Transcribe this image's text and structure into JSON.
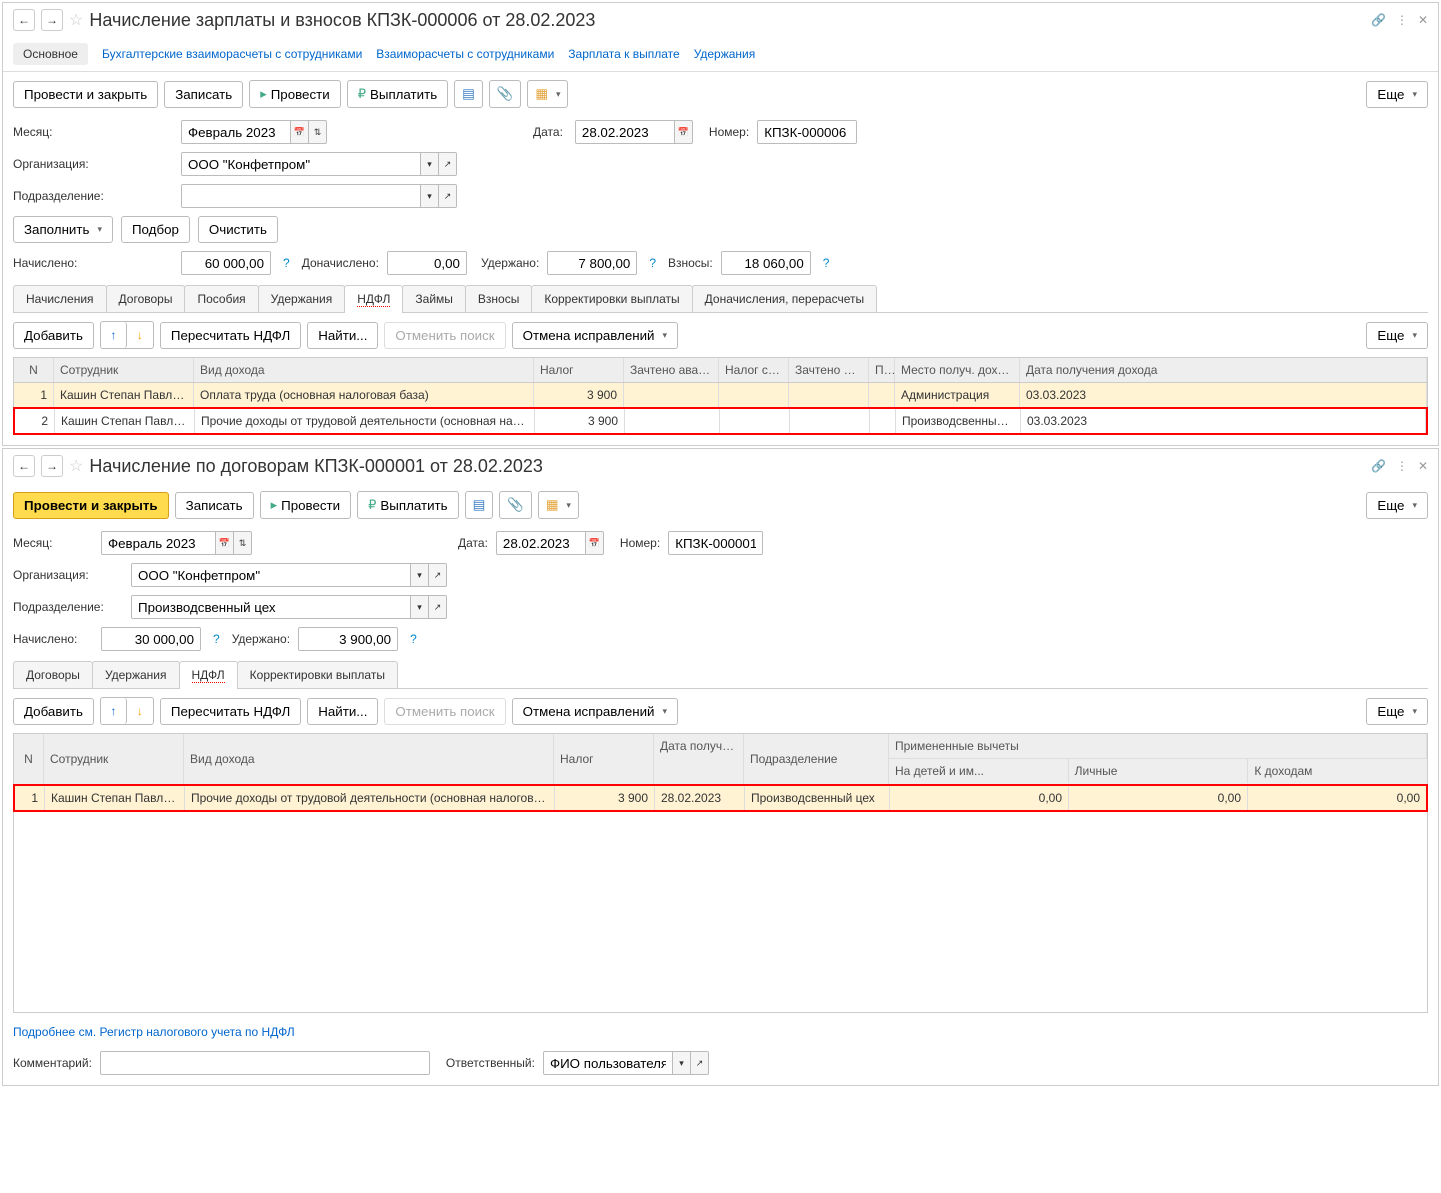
{
  "doc1": {
    "title": "Начисление зарплаты и взносов КПЗК-000006 от 28.02.2023",
    "nav_tabs": {
      "main": "Основное",
      "link1": "Бухгалтерские взаиморасчеты с сотрудниками",
      "link2": "Взаиморасчеты с сотрудниками",
      "link3": "Зарплата к выплате",
      "link4": "Удержания"
    },
    "toolbar": {
      "post_close": "Провести и закрыть",
      "save": "Записать",
      "post": "Провести",
      "pay": "Выплатить",
      "more": "Еще"
    },
    "fields": {
      "month_label": "Месяц:",
      "month_value": "Февраль 2023",
      "date_label": "Дата:",
      "date_value": "28.02.2023",
      "number_label": "Номер:",
      "number_value": "КПЗК-000006",
      "org_label": "Организация:",
      "org_value": "ООО \"Конфетпром\"",
      "dept_label": "Подразделение:",
      "dept_value": "",
      "fill": "Заполнить",
      "select": "Подбор",
      "clear": "Очистить",
      "accrued_label": "Начислено:",
      "accrued_value": "60 000,00",
      "accrued_extra_label": "Доначислено:",
      "accrued_extra_value": "0,00",
      "withheld_label": "Удержано:",
      "withheld_value": "7 800,00",
      "contrib_label": "Взносы:",
      "contrib_value": "18 060,00"
    },
    "tabs": [
      "Начисления",
      "Договоры",
      "Пособия",
      "Удержания",
      "НДФЛ",
      "Займы",
      "Взносы",
      "Корректировки выплаты",
      "Доначисления, перерасчеты"
    ],
    "active_tab": "НДФЛ",
    "sub_toolbar": {
      "add": "Добавить",
      "recalc": "Пересчитать НДФЛ",
      "find": "Найти...",
      "cancel_search": "Отменить поиск",
      "undo_fix": "Отмена исправлений",
      "more": "Еще"
    },
    "table": {
      "headers": [
        "N",
        "Сотрудник",
        "Вид дохода",
        "Налог",
        "Зачтено авансов",
        "Налог с пр...",
        "Зачтено аван...",
        "П...",
        "Место получ. дохода",
        "Дата получения дохода"
      ],
      "rows": [
        {
          "n": "1",
          "emp": "Кашин Степан Павлович",
          "income": "Оплата труда (основная налоговая база)",
          "tax": "3 900",
          "adv": "",
          "taxp": "",
          "adv2": "",
          "p": "",
          "place": "Администрация",
          "date": "03.03.2023",
          "sel": true
        },
        {
          "n": "2",
          "emp": "Кашин Степан Павлович",
          "income": "Прочие доходы от трудовой деятельности (основная налоговая база)",
          "tax": "3 900",
          "adv": "",
          "taxp": "",
          "adv2": "",
          "p": "",
          "place": "Производсвенный цех",
          "date": "03.03.2023",
          "sel": false
        }
      ]
    }
  },
  "doc2": {
    "title": "Начисление по договорам КПЗК-000001 от 28.02.2023",
    "toolbar": {
      "post_close": "Провести и закрыть",
      "save": "Записать",
      "post": "Провести",
      "pay": "Выплатить",
      "more": "Еще"
    },
    "fields": {
      "month_label": "Месяц:",
      "month_value": "Февраль 2023",
      "date_label": "Дата:",
      "date_value": "28.02.2023",
      "number_label": "Номер:",
      "number_value": "КПЗК-000001",
      "org_label": "Организация:",
      "org_value": "ООО \"Конфетпром\"",
      "dept_label": "Подразделение:",
      "dept_value": "Производсвенный цех",
      "accrued_label": "Начислено:",
      "accrued_value": "30 000,00",
      "withheld_label": "Удержано:",
      "withheld_value": "3 900,00"
    },
    "tabs": [
      "Договоры",
      "Удержания",
      "НДФЛ",
      "Корректировки выплаты"
    ],
    "active_tab": "НДФЛ",
    "sub_toolbar": {
      "add": "Добавить",
      "recalc": "Пересчитать НДФЛ",
      "find": "Найти...",
      "cancel_search": "Отменить поиск",
      "undo_fix": "Отмена исправлений",
      "more": "Еще"
    },
    "table": {
      "header_main": [
        "N",
        "Сотрудник",
        "Вид дохода",
        "Налог",
        "Дата получения ...",
        "Подразделение",
        "Примененные вычеты"
      ],
      "header_sub": [
        "На детей и им...",
        "Личные",
        "К доходам"
      ],
      "rows": [
        {
          "n": "1",
          "emp": "Кашин Степан Павлович",
          "income": "Прочие доходы от трудовой деятельности (основная налоговая база)",
          "tax": "3 900",
          "date": "28.02.2023",
          "dept": "Производсвенный цех",
          "kids": "0,00",
          "pers": "0,00",
          "inc": "0,00"
        }
      ]
    },
    "footer": {
      "link": "Подробнее см. Регистр налогового учета по НДФЛ",
      "comment_label": "Комментарий:",
      "comment_value": "",
      "resp_label": "Ответственный:",
      "resp_value": "ФИО пользователя"
    }
  }
}
